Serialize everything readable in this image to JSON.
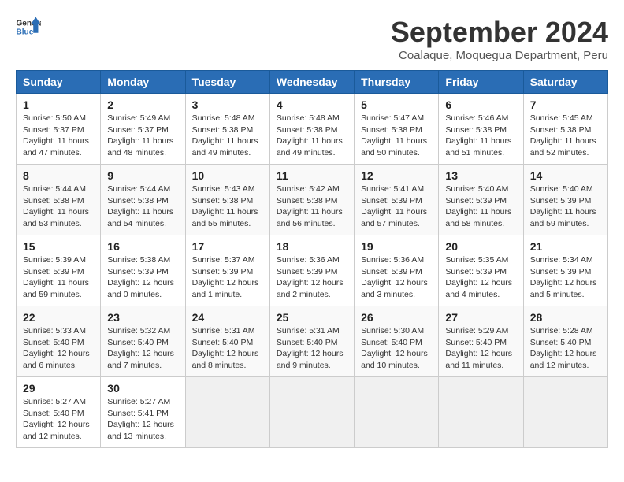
{
  "header": {
    "logo_line1": "General",
    "logo_line2": "Blue",
    "title": "September 2024",
    "subtitle": "Coalaque, Moquegua Department, Peru"
  },
  "weekdays": [
    "Sunday",
    "Monday",
    "Tuesday",
    "Wednesday",
    "Thursday",
    "Friday",
    "Saturday"
  ],
  "weeks": [
    [
      {
        "day": "1",
        "sunrise": "5:50 AM",
        "sunset": "5:37 PM",
        "daylight": "11 hours and 47 minutes."
      },
      {
        "day": "2",
        "sunrise": "5:49 AM",
        "sunset": "5:37 PM",
        "daylight": "11 hours and 48 minutes."
      },
      {
        "day": "3",
        "sunrise": "5:48 AM",
        "sunset": "5:38 PM",
        "daylight": "11 hours and 49 minutes."
      },
      {
        "day": "4",
        "sunrise": "5:48 AM",
        "sunset": "5:38 PM",
        "daylight": "11 hours and 49 minutes."
      },
      {
        "day": "5",
        "sunrise": "5:47 AM",
        "sunset": "5:38 PM",
        "daylight": "11 hours and 50 minutes."
      },
      {
        "day": "6",
        "sunrise": "5:46 AM",
        "sunset": "5:38 PM",
        "daylight": "11 hours and 51 minutes."
      },
      {
        "day": "7",
        "sunrise": "5:45 AM",
        "sunset": "5:38 PM",
        "daylight": "11 hours and 52 minutes."
      }
    ],
    [
      {
        "day": "8",
        "sunrise": "5:44 AM",
        "sunset": "5:38 PM",
        "daylight": "11 hours and 53 minutes."
      },
      {
        "day": "9",
        "sunrise": "5:44 AM",
        "sunset": "5:38 PM",
        "daylight": "11 hours and 54 minutes."
      },
      {
        "day": "10",
        "sunrise": "5:43 AM",
        "sunset": "5:38 PM",
        "daylight": "11 hours and 55 minutes."
      },
      {
        "day": "11",
        "sunrise": "5:42 AM",
        "sunset": "5:38 PM",
        "daylight": "11 hours and 56 minutes."
      },
      {
        "day": "12",
        "sunrise": "5:41 AM",
        "sunset": "5:39 PM",
        "daylight": "11 hours and 57 minutes."
      },
      {
        "day": "13",
        "sunrise": "5:40 AM",
        "sunset": "5:39 PM",
        "daylight": "11 hours and 58 minutes."
      },
      {
        "day": "14",
        "sunrise": "5:40 AM",
        "sunset": "5:39 PM",
        "daylight": "11 hours and 59 minutes."
      }
    ],
    [
      {
        "day": "15",
        "sunrise": "5:39 AM",
        "sunset": "5:39 PM",
        "daylight": "11 hours and 59 minutes."
      },
      {
        "day": "16",
        "sunrise": "5:38 AM",
        "sunset": "5:39 PM",
        "daylight": "12 hours and 0 minutes."
      },
      {
        "day": "17",
        "sunrise": "5:37 AM",
        "sunset": "5:39 PM",
        "daylight": "12 hours and 1 minute."
      },
      {
        "day": "18",
        "sunrise": "5:36 AM",
        "sunset": "5:39 PM",
        "daylight": "12 hours and 2 minutes."
      },
      {
        "day": "19",
        "sunrise": "5:36 AM",
        "sunset": "5:39 PM",
        "daylight": "12 hours and 3 minutes."
      },
      {
        "day": "20",
        "sunrise": "5:35 AM",
        "sunset": "5:39 PM",
        "daylight": "12 hours and 4 minutes."
      },
      {
        "day": "21",
        "sunrise": "5:34 AM",
        "sunset": "5:39 PM",
        "daylight": "12 hours and 5 minutes."
      }
    ],
    [
      {
        "day": "22",
        "sunrise": "5:33 AM",
        "sunset": "5:40 PM",
        "daylight": "12 hours and 6 minutes."
      },
      {
        "day": "23",
        "sunrise": "5:32 AM",
        "sunset": "5:40 PM",
        "daylight": "12 hours and 7 minutes."
      },
      {
        "day": "24",
        "sunrise": "5:31 AM",
        "sunset": "5:40 PM",
        "daylight": "12 hours and 8 minutes."
      },
      {
        "day": "25",
        "sunrise": "5:31 AM",
        "sunset": "5:40 PM",
        "daylight": "12 hours and 9 minutes."
      },
      {
        "day": "26",
        "sunrise": "5:30 AM",
        "sunset": "5:40 PM",
        "daylight": "12 hours and 10 minutes."
      },
      {
        "day": "27",
        "sunrise": "5:29 AM",
        "sunset": "5:40 PM",
        "daylight": "12 hours and 11 minutes."
      },
      {
        "day": "28",
        "sunrise": "5:28 AM",
        "sunset": "5:40 PM",
        "daylight": "12 hours and 12 minutes."
      }
    ],
    [
      {
        "day": "29",
        "sunrise": "5:27 AM",
        "sunset": "5:40 PM",
        "daylight": "12 hours and 12 minutes."
      },
      {
        "day": "30",
        "sunrise": "5:27 AM",
        "sunset": "5:41 PM",
        "daylight": "12 hours and 13 minutes."
      },
      null,
      null,
      null,
      null,
      null
    ]
  ]
}
